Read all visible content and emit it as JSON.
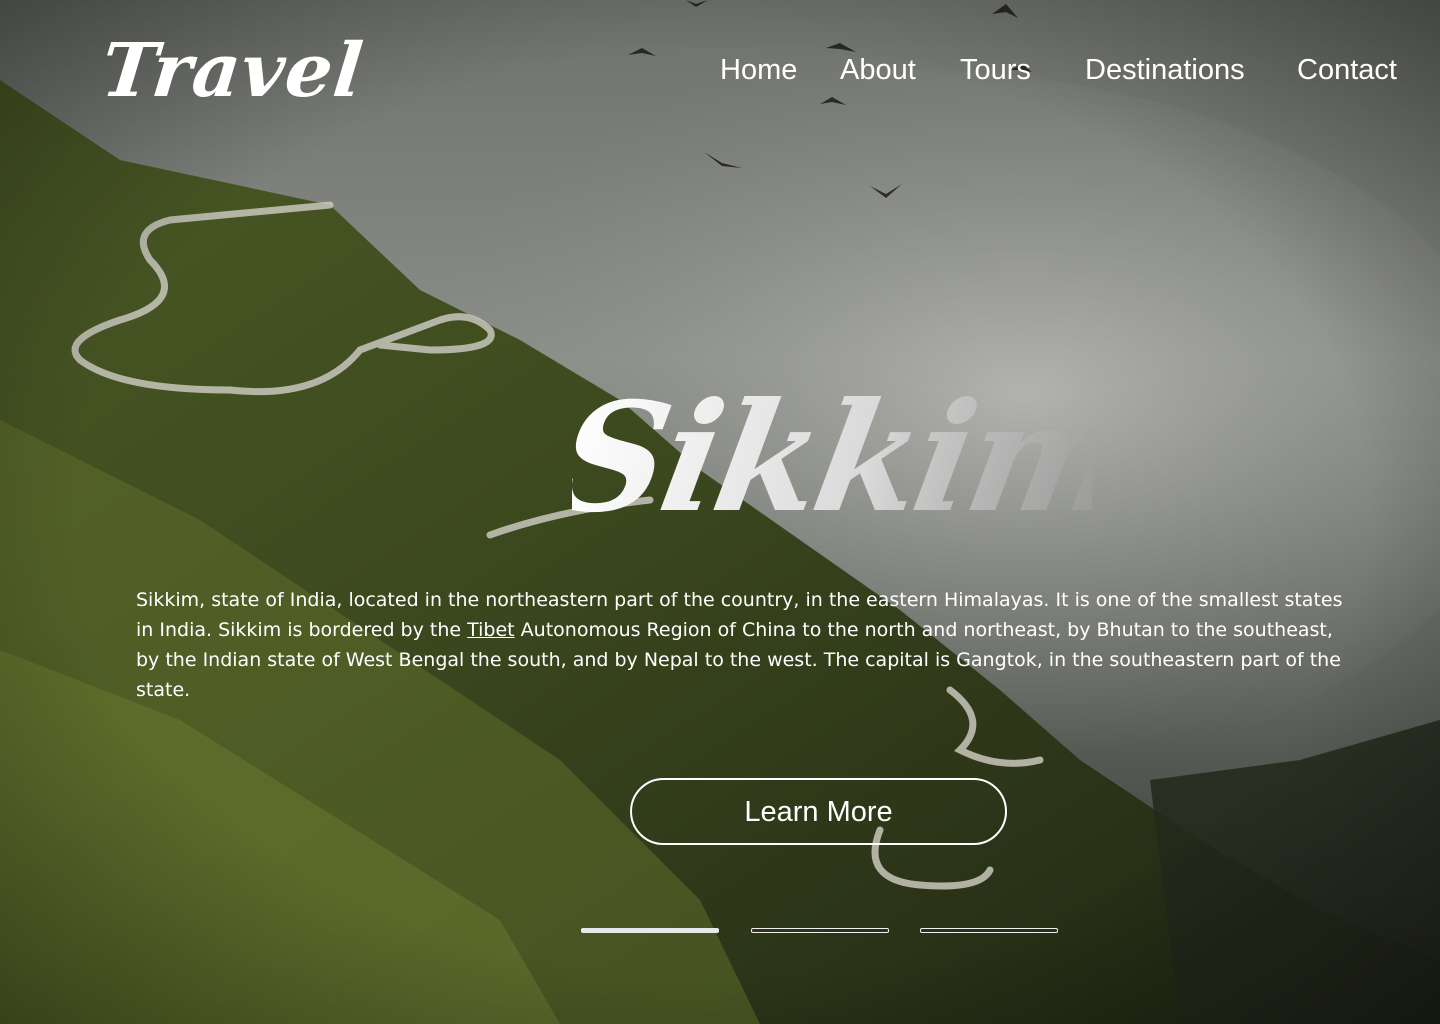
{
  "brand": {
    "logo": "Travel"
  },
  "nav": {
    "items": [
      {
        "label": "Home"
      },
      {
        "label": "About"
      },
      {
        "label": "Tours"
      },
      {
        "label": "Destinations"
      },
      {
        "label": "Contact"
      }
    ]
  },
  "hero": {
    "title": "Sikkim",
    "description_part1": "Sikkim, state of India, located in the northeastern part of the country, in the eastern Himalayas. It is one of the smallest states in India. Sikkim is bordered by the ",
    "description_link": "Tibet",
    "description_part2": " Autonomous Region of China to the north and northeast, by Bhutan to the southeast, by the Indian state of West Bengal the south, and by Nepal to the west. The capital is Gangtok, in the southeastern part of the state.",
    "cta_label": "Learn More"
  },
  "carousel": {
    "slide_count": 3,
    "active_index": 0
  },
  "colors": {
    "text": "#ffffff",
    "sky": "#7d807b",
    "mountain": "#3b4a22"
  }
}
